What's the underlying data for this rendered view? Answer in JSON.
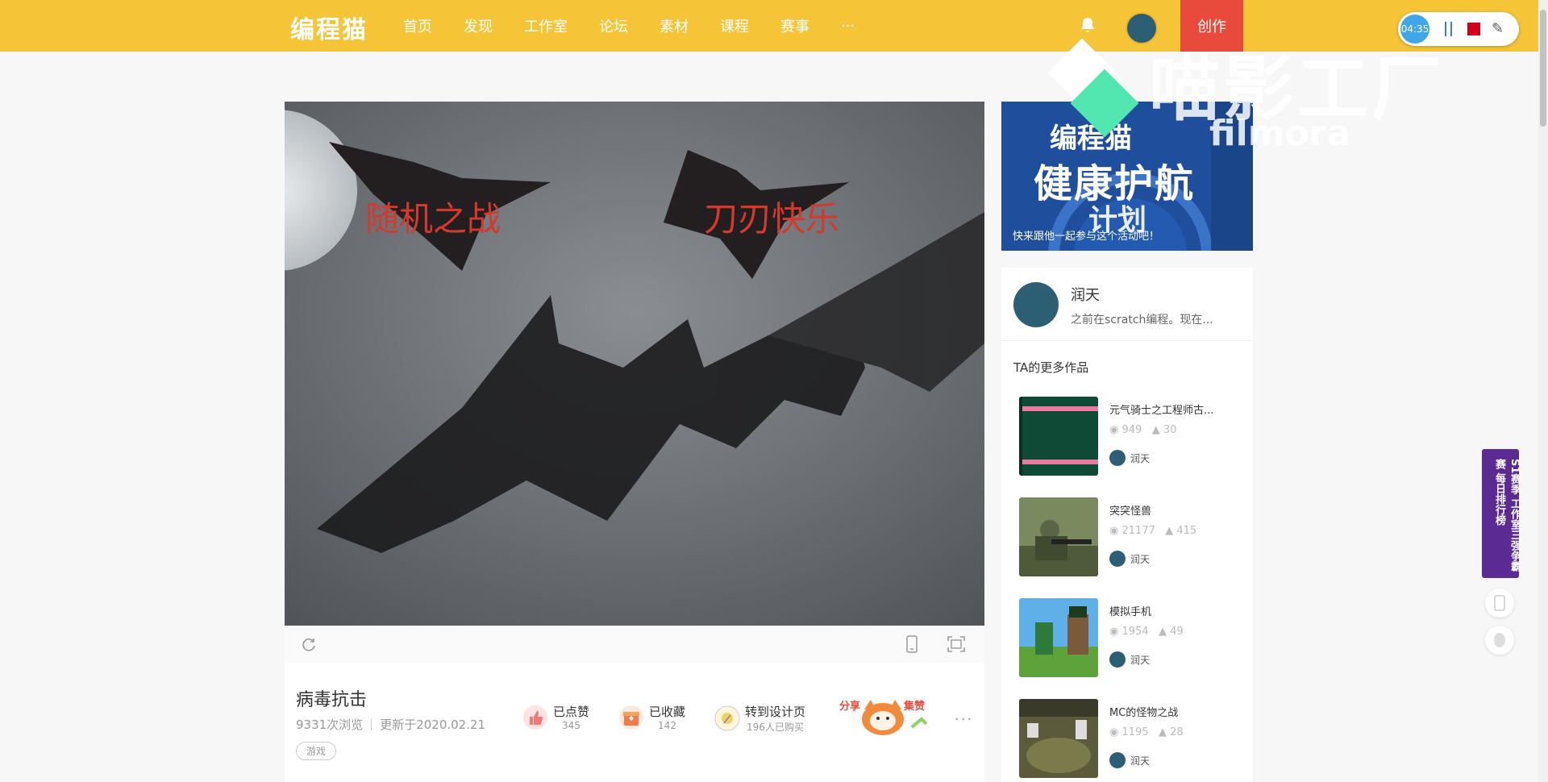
{
  "nav": {
    "logo": "编程猫",
    "items": [
      "首页",
      "发现",
      "工作室",
      "论坛",
      "素材",
      "课程",
      "赛事",
      "···"
    ],
    "create": "创作"
  },
  "recorder": {
    "time": "04:35"
  },
  "watermark": {
    "text": "喵影工厂",
    "sub": "filmora"
  },
  "banner": {
    "title1": "编程猫",
    "title2": "健康护航",
    "title3": "计划",
    "caption": "快来跟他一起参与这个活动吧！"
  },
  "player": {
    "label1": "随机之战",
    "label2": "刀刃快乐"
  },
  "work": {
    "title": "病毒抗击",
    "views": "9331次浏览",
    "updated": "更新于2020.02.21",
    "tag": "游戏",
    "like_label": "已点赞",
    "like_count": "345",
    "fav_label": "已收藏",
    "fav_count": "142",
    "design_label": "转到设计页",
    "design_count": "196人已购买",
    "share_text": "分享 集赞"
  },
  "author": {
    "name": "润天",
    "bio": "之前在scratch编程。现在..."
  },
  "more_title": "TA的更多作品",
  "more_works": [
    {
      "title": "元气骑士之工程师古...",
      "views": "949",
      "likes": "30",
      "author": "润天"
    },
    {
      "title": "突突怪兽",
      "views": "21177",
      "likes": "415",
      "author": "润天"
    },
    {
      "title": "模拟手机",
      "views": "1954",
      "likes": "49",
      "author": "润天"
    },
    {
      "title": "MC的怪物之战",
      "views": "1195",
      "likes": "28",
      "author": "润天"
    }
  ],
  "float_banner": "S1赛季 工作室三强争霸赛 每日排行榜"
}
